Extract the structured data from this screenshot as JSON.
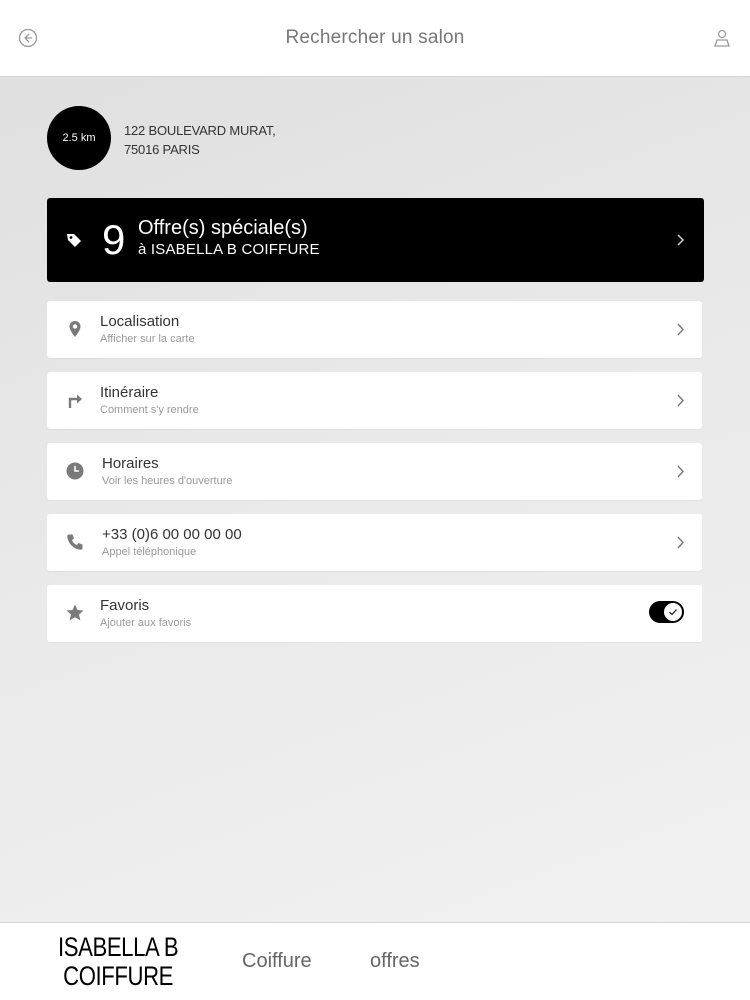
{
  "header": {
    "title": "Rechercher un salon",
    "back_icon": "back-arrow-circle-icon",
    "profile_icon": "user-location-icon"
  },
  "salon": {
    "distance": "2.5 km",
    "address_line1": "122 BOULEVARD MURAT,",
    "address_line2": "75016 PARIS"
  },
  "offers": {
    "count": "9",
    "title": "Offre(s) spéciale(s)",
    "subtitle": "à ISABELLA B COIFFURE",
    "icon": "tag-icon"
  },
  "rows": [
    {
      "label": "Localisation",
      "sub": "Afficher sur la carte",
      "icon": "location-pin-icon"
    },
    {
      "label": "Itinéraire",
      "sub": "Comment s'y rendre",
      "icon": "turn-right-arrow-icon"
    },
    {
      "label": "Horaires",
      "sub": "Voir les heures d'ouverture",
      "icon": "clock-icon"
    },
    {
      "label": "+33 (0)6 00 00 00 00",
      "sub": "Appel téléphonique",
      "icon": "phone-icon"
    },
    {
      "label": "Favoris",
      "sub": "Ajouter aux favoris",
      "icon": "star-icon",
      "toggle_on": true
    }
  ],
  "footer": {
    "brand_line1": "ISABELLA B",
    "brand_line2": "COIFFURE",
    "tab_coiffure": "Coiffure",
    "tab_offres": "offres"
  },
  "colors": {
    "accent": "#000000",
    "icon_gray": "#7a7a7a",
    "background": "#e6e6e6"
  }
}
